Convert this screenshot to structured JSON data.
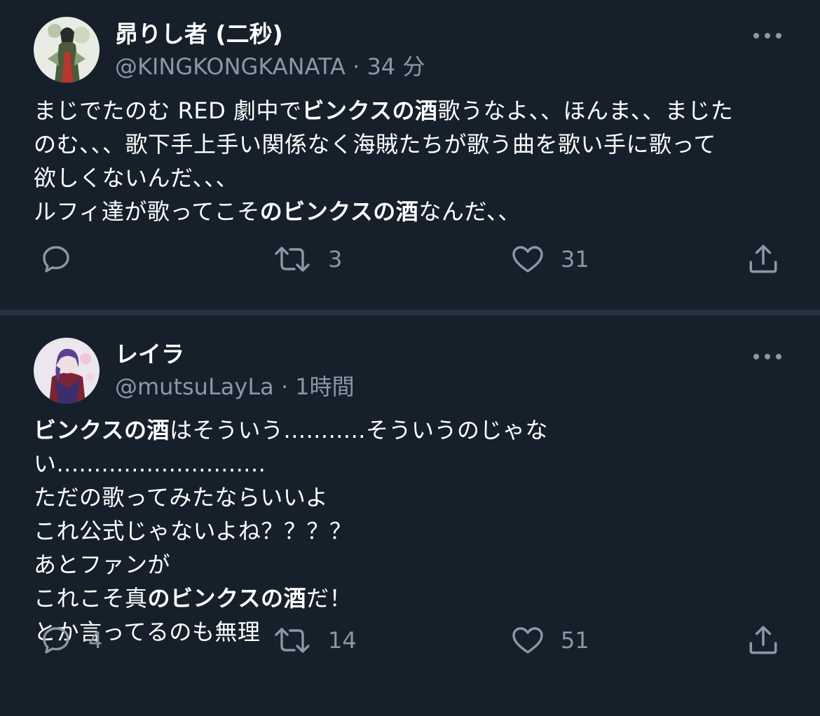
{
  "tweets": [
    {
      "name": "昴りし者 (二秒)",
      "handle": "@KINGKONGKANATA",
      "separator": "·",
      "time": "34 分",
      "lines": [
        [
          {
            "t": "まじでたのむ RED 劇中で"
          },
          {
            "t": "ビンクスの酒",
            "b": true
          },
          {
            "t": "歌うなよ、、ほんま、、まじた"
          }
        ],
        [
          {
            "t": "のむ、、、歌下手上手い関係なく海賊たちが歌う曲を歌い手に歌って"
          }
        ],
        [
          {
            "t": "欲しくないんだ、、、"
          }
        ],
        [
          {
            "t": "ルフィ達が歌ってこそ"
          },
          {
            "t": "のビンクスの酒",
            "b": true
          },
          {
            "t": "なんだ、、"
          }
        ]
      ],
      "reply_count": "",
      "retweet_count": "3",
      "like_count": "31"
    },
    {
      "name": "レイラ",
      "handle": "@mutsuLayLa",
      "separator": "·",
      "time": "1時間",
      "lines": [
        [
          {
            "t": "ビンクスの酒",
            "b": true
          },
          {
            "t": "はそういう...........そういうのじゃな"
          }
        ],
        [
          {
            "t": "い............................"
          }
        ],
        [
          {
            "t": "ただの歌ってみたならいいよ"
          }
        ],
        [
          {
            "t": "これ公式じゃないよね？？？？"
          }
        ],
        [
          {
            "t": "あとファンが"
          }
        ],
        [
          {
            "t": "これこそ真"
          },
          {
            "t": "のビンクスの酒",
            "b": true
          },
          {
            "t": "だ！"
          }
        ],
        [
          {
            "t": "とか言ってるのも無理"
          }
        ]
      ],
      "reply_count": "4",
      "retweet_count": "14",
      "like_count": "51"
    }
  ],
  "colors": {
    "background": "#15202b",
    "divider": "#25323f",
    "secondary_text": "#8899a6",
    "primary_text": "#ffffff"
  },
  "icons": {
    "reply": "reply-icon",
    "retweet": "retweet-icon",
    "like": "heart-icon",
    "share": "share-icon",
    "more": "more-icon"
  }
}
